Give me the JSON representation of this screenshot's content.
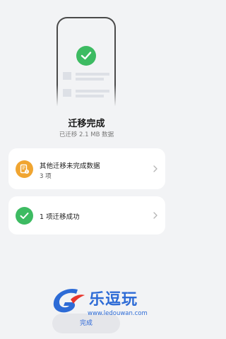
{
  "illustration": {
    "icon": "check-icon",
    "accent_color": "#3dbb62"
  },
  "status": {
    "title": "迁移完成",
    "subtitle": "已迁移 2.1 MB 数据"
  },
  "cards": [
    {
      "title": "其他迁移未完成数据",
      "subtitle": "3 项",
      "icon": "document-warning-icon",
      "icon_color": "#f0a531"
    },
    {
      "title": "1 项迁移成功",
      "icon": "check-icon",
      "icon_color": "#3dbb62"
    }
  ],
  "footer": {
    "done_label": "完成"
  },
  "watermark": {
    "brand": "乐逗玩",
    "url": "www.ledouwan.com"
  }
}
